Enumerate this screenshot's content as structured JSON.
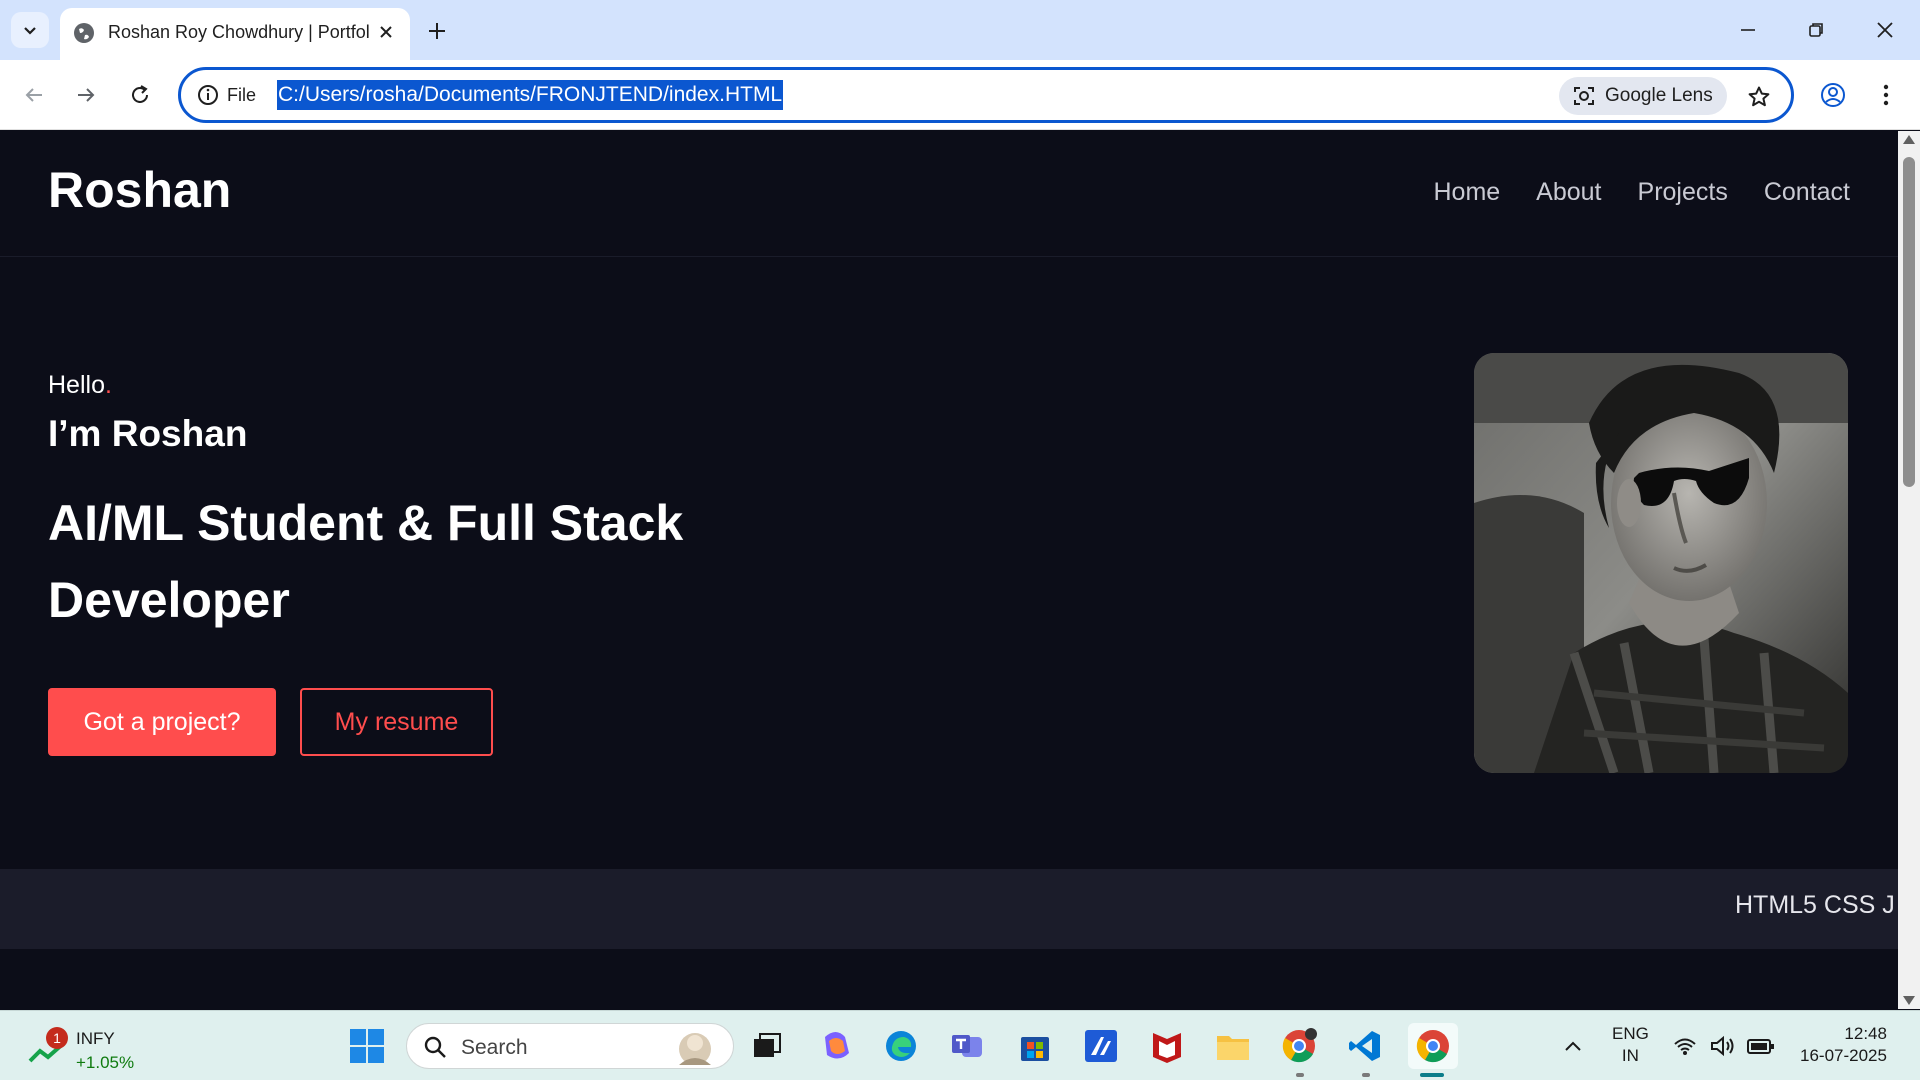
{
  "browser": {
    "tab": {
      "title": "Roshan Roy Chowdhury | Portfolio"
    },
    "omnibox": {
      "scheme_label": "File",
      "url": "C:/Users/rosha/Documents/FRONJTEND/index.HTML"
    },
    "lens_label": "Google Lens"
  },
  "site": {
    "logo": "Roshan",
    "nav": [
      "Home",
      "About",
      "Projects",
      "Contact"
    ],
    "hero": {
      "hello": "Hello",
      "hello_dot": ".",
      "intro": "I’m Roshan",
      "headline": "AI/ML Student & Full Stack Developer",
      "primary_button": "Got a project?",
      "secondary_button": "My resume"
    },
    "skills_marquee": "HTML5 CSS J"
  },
  "taskbar": {
    "stock": {
      "name": "INFY",
      "change": "+1.05%",
      "badge": "1"
    },
    "search_label": "Search",
    "lang": {
      "line1": "ENG",
      "line2": "IN"
    },
    "clock": {
      "time": "12:48",
      "date": "16-07-2025"
    }
  },
  "colors": {
    "page_bg": "#0c0d18",
    "accent": "#ff4d4d",
    "band_bg": "#1b1c2a",
    "omnibox_border": "#0b57d0"
  }
}
